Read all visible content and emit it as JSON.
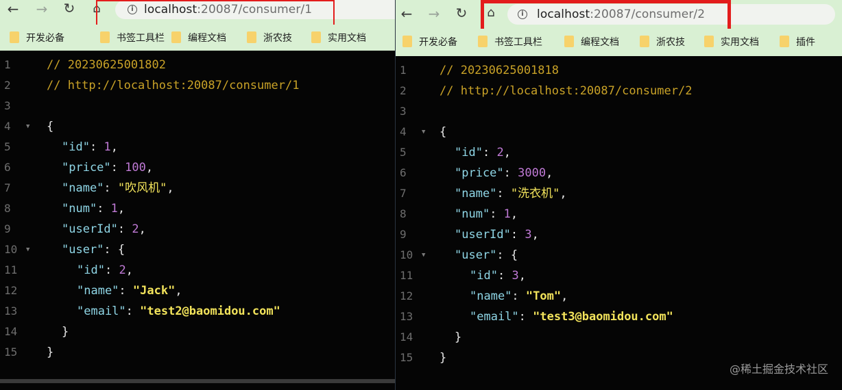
{
  "left": {
    "url_host": "localhost",
    "url_path": ":20087/consumer/1",
    "bookmarks": [
      "开发必备",
      "书签工具栏",
      "编程文档",
      "浙农技",
      "实用文档"
    ],
    "lines": [
      {
        "n": "1",
        "fold": false,
        "indent": 0,
        "t": [
          {
            "c": "cmt",
            "v": "// 20230625001802"
          }
        ]
      },
      {
        "n": "2",
        "fold": false,
        "indent": 0,
        "t": [
          {
            "c": "cmt",
            "v": "// http://localhost:20087/consumer/1"
          }
        ]
      },
      {
        "n": "3",
        "fold": false,
        "indent": 0,
        "t": []
      },
      {
        "n": "4",
        "fold": true,
        "indent": 0,
        "t": [
          {
            "c": "pun",
            "v": "{"
          }
        ]
      },
      {
        "n": "5",
        "fold": false,
        "indent": 1,
        "t": [
          {
            "c": "key",
            "v": "\"id\""
          },
          {
            "c": "pun",
            "v": ": "
          },
          {
            "c": "num",
            "v": "1"
          },
          {
            "c": "pun",
            "v": ","
          }
        ]
      },
      {
        "n": "6",
        "fold": false,
        "indent": 1,
        "t": [
          {
            "c": "key",
            "v": "\"price\""
          },
          {
            "c": "pun",
            "v": ": "
          },
          {
            "c": "num",
            "v": "100"
          },
          {
            "c": "pun",
            "v": ","
          }
        ]
      },
      {
        "n": "7",
        "fold": false,
        "indent": 1,
        "t": [
          {
            "c": "key",
            "v": "\"name\""
          },
          {
            "c": "pun",
            "v": ": "
          },
          {
            "c": "str",
            "v": "\"吹风机\""
          },
          {
            "c": "pun",
            "v": ","
          }
        ]
      },
      {
        "n": "8",
        "fold": false,
        "indent": 1,
        "t": [
          {
            "c": "key",
            "v": "\"num\""
          },
          {
            "c": "pun",
            "v": ": "
          },
          {
            "c": "num",
            "v": "1"
          },
          {
            "c": "pun",
            "v": ","
          }
        ]
      },
      {
        "n": "9",
        "fold": false,
        "indent": 1,
        "t": [
          {
            "c": "key",
            "v": "\"userId\""
          },
          {
            "c": "pun",
            "v": ": "
          },
          {
            "c": "num",
            "v": "2"
          },
          {
            "c": "pun",
            "v": ","
          }
        ]
      },
      {
        "n": "10",
        "fold": true,
        "indent": 1,
        "t": [
          {
            "c": "key",
            "v": "\"user\""
          },
          {
            "c": "pun",
            "v": ": {"
          }
        ]
      },
      {
        "n": "11",
        "fold": false,
        "indent": 2,
        "t": [
          {
            "c": "key",
            "v": "\"id\""
          },
          {
            "c": "pun",
            "v": ": "
          },
          {
            "c": "num",
            "v": "2"
          },
          {
            "c": "pun",
            "v": ","
          }
        ]
      },
      {
        "n": "12",
        "fold": false,
        "indent": 2,
        "t": [
          {
            "c": "key",
            "v": "\"name\""
          },
          {
            "c": "pun",
            "v": ": "
          },
          {
            "c": "strb",
            "v": "\"Jack\""
          },
          {
            "c": "pun",
            "v": ","
          }
        ]
      },
      {
        "n": "13",
        "fold": false,
        "indent": 2,
        "t": [
          {
            "c": "key",
            "v": "\"email\""
          },
          {
            "c": "pun",
            "v": ": "
          },
          {
            "c": "strb",
            "v": "\"test2@baomidou.com\""
          }
        ]
      },
      {
        "n": "14",
        "fold": false,
        "indent": 1,
        "t": [
          {
            "c": "pun",
            "v": "}"
          }
        ]
      },
      {
        "n": "15",
        "fold": false,
        "indent": 0,
        "t": [
          {
            "c": "pun",
            "v": "}"
          }
        ]
      }
    ]
  },
  "right": {
    "url_host": "localhost",
    "url_path": ":20087/consumer/2",
    "bookmarks": [
      "开发必备",
      "书签工具栏",
      "编程文档",
      "浙农技",
      "实用文档",
      "插件"
    ],
    "lines": [
      {
        "n": "1",
        "fold": false,
        "indent": 0,
        "t": [
          {
            "c": "cmt",
            "v": "// 20230625001818"
          }
        ]
      },
      {
        "n": "2",
        "fold": false,
        "indent": 0,
        "t": [
          {
            "c": "cmt",
            "v": "// http://localhost:20087/consumer/2"
          }
        ]
      },
      {
        "n": "3",
        "fold": false,
        "indent": 0,
        "t": []
      },
      {
        "n": "4",
        "fold": true,
        "indent": 0,
        "t": [
          {
            "c": "pun",
            "v": "{"
          }
        ]
      },
      {
        "n": "5",
        "fold": false,
        "indent": 1,
        "t": [
          {
            "c": "key",
            "v": "\"id\""
          },
          {
            "c": "pun",
            "v": ": "
          },
          {
            "c": "num",
            "v": "2"
          },
          {
            "c": "pun",
            "v": ","
          }
        ]
      },
      {
        "n": "6",
        "fold": false,
        "indent": 1,
        "t": [
          {
            "c": "key",
            "v": "\"price\""
          },
          {
            "c": "pun",
            "v": ": "
          },
          {
            "c": "num",
            "v": "3000"
          },
          {
            "c": "pun",
            "v": ","
          }
        ]
      },
      {
        "n": "7",
        "fold": false,
        "indent": 1,
        "t": [
          {
            "c": "key",
            "v": "\"name\""
          },
          {
            "c": "pun",
            "v": ": "
          },
          {
            "c": "str",
            "v": "\"洗衣机\""
          },
          {
            "c": "pun",
            "v": ","
          }
        ]
      },
      {
        "n": "8",
        "fold": false,
        "indent": 1,
        "t": [
          {
            "c": "key",
            "v": "\"num\""
          },
          {
            "c": "pun",
            "v": ": "
          },
          {
            "c": "num",
            "v": "1"
          },
          {
            "c": "pun",
            "v": ","
          }
        ]
      },
      {
        "n": "9",
        "fold": false,
        "indent": 1,
        "t": [
          {
            "c": "key",
            "v": "\"userId\""
          },
          {
            "c": "pun",
            "v": ": "
          },
          {
            "c": "num",
            "v": "3"
          },
          {
            "c": "pun",
            "v": ","
          }
        ]
      },
      {
        "n": "10",
        "fold": true,
        "indent": 1,
        "t": [
          {
            "c": "key",
            "v": "\"user\""
          },
          {
            "c": "pun",
            "v": ": {"
          }
        ]
      },
      {
        "n": "11",
        "fold": false,
        "indent": 2,
        "t": [
          {
            "c": "key",
            "v": "\"id\""
          },
          {
            "c": "pun",
            "v": ": "
          },
          {
            "c": "num",
            "v": "3"
          },
          {
            "c": "pun",
            "v": ","
          }
        ]
      },
      {
        "n": "12",
        "fold": false,
        "indent": 2,
        "t": [
          {
            "c": "key",
            "v": "\"name\""
          },
          {
            "c": "pun",
            "v": ": "
          },
          {
            "c": "strb",
            "v": "\"Tom\""
          },
          {
            "c": "pun",
            "v": ","
          }
        ]
      },
      {
        "n": "13",
        "fold": false,
        "indent": 2,
        "t": [
          {
            "c": "key",
            "v": "\"email\""
          },
          {
            "c": "pun",
            "v": ": "
          },
          {
            "c": "strb",
            "v": "\"test3@baomidou.com\""
          }
        ]
      },
      {
        "n": "14",
        "fold": false,
        "indent": 1,
        "t": [
          {
            "c": "pun",
            "v": "}"
          }
        ]
      },
      {
        "n": "15",
        "fold": false,
        "indent": 0,
        "t": [
          {
            "c": "pun",
            "v": "}"
          }
        ]
      }
    ]
  },
  "icons": {
    "back": "back-arrow-icon",
    "forward": "forward-arrow-icon",
    "reload": "reload-icon",
    "home": "home-icon",
    "info": "info-icon",
    "folder": "folder-icon",
    "fold": "fold-triangle-icon"
  },
  "colors": {
    "highlight_box": "#e31c1c",
    "toolbar": "#d9f0d3",
    "editor_bg": "#050505"
  },
  "watermark": "@稀土掘金技术社区"
}
